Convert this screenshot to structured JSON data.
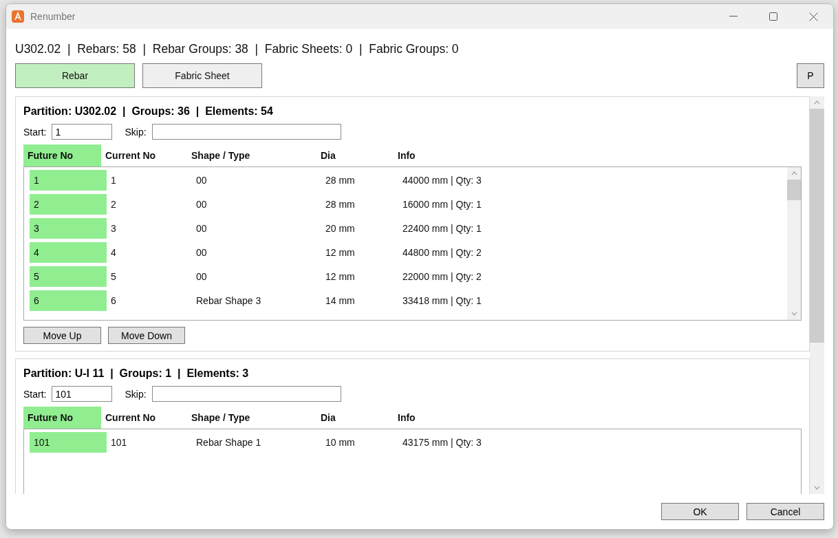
{
  "window": {
    "title": "Renumber"
  },
  "summary": "U302.02  |  Rebars: 58  |  Rebar Groups: 38  |  Fabric Sheets: 0  |  Fabric Groups: 0",
  "mode_tabs": [
    {
      "label": "Rebar",
      "selected": true
    },
    {
      "label": "Fabric Sheet",
      "selected": false
    }
  ],
  "p_button": "P",
  "partitions": [
    {
      "title": "Partition: U302.02  |  Groups: 36  |  Elements: 54",
      "start_label": "Start:",
      "start": "1",
      "skip_label": "Skip:",
      "columns": [
        "Future No",
        "Current No",
        "Shape / Type",
        "Dia",
        "Info"
      ],
      "rows": [
        {
          "future": "1",
          "current": "1",
          "shape": "00",
          "dia": "28 mm",
          "info": "44000 mm | Qty: 3"
        },
        {
          "future": "2",
          "current": "2",
          "shape": "00",
          "dia": "28 mm",
          "info": "16000 mm | Qty: 1"
        },
        {
          "future": "3",
          "current": "3",
          "shape": "00",
          "dia": "20 mm",
          "info": "22400 mm | Qty: 1"
        },
        {
          "future": "4",
          "current": "4",
          "shape": "00",
          "dia": "12 mm",
          "info": "44800 mm | Qty: 2"
        },
        {
          "future": "5",
          "current": "5",
          "shape": "00",
          "dia": "12 mm",
          "info": "22000 mm | Qty: 2"
        },
        {
          "future": "6",
          "current": "6",
          "shape": "Rebar Shape 3",
          "dia": "14 mm",
          "info": "33418 mm | Qty: 1"
        }
      ],
      "buttons": [
        "Move Up",
        "Move Down"
      ]
    },
    {
      "title": "Partition: U-I 11  |  Groups: 1  |  Elements: 3",
      "start_label": "Start:",
      "start": "101",
      "skip_label": "Skip:",
      "columns": [
        "Future No",
        "Current No",
        "Shape / Type",
        "Dia",
        "Info"
      ],
      "rows": [
        {
          "future": "101",
          "current": "101",
          "shape": "Rebar Shape 1",
          "dia": "10 mm",
          "info": "43175 mm | Qty: 3"
        }
      ]
    }
  ],
  "footer_buttons": [
    "OK",
    "Cancel"
  ]
}
